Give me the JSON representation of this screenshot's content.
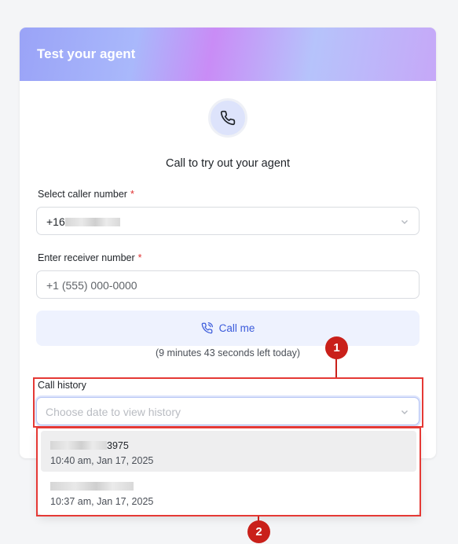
{
  "card": {
    "title": "Test your agent",
    "subtitle": "Call to try out your agent",
    "phone_icon": "phone-icon"
  },
  "caller": {
    "label": "Select caller number",
    "required_mark": "*",
    "value_prefix": "+16",
    "dropdown_icon": "chevron-down-icon"
  },
  "receiver": {
    "label": "Enter receiver number",
    "required_mark": "*",
    "placeholder": "+1 (555) 000-0000"
  },
  "call_button": {
    "label": "Call me",
    "icon": "phone-call-icon"
  },
  "time_left": "(9 minutes 43 seconds left today)",
  "history": {
    "label": "Call history",
    "placeholder": "Choose date to view history",
    "dropdown_icon": "chevron-down-icon",
    "items": [
      {
        "number_suffix": "3975",
        "time": "10:40 am, Jan 17, 2025"
      },
      {
        "number_suffix": "",
        "time": "10:37 am, Jan 17, 2025"
      }
    ]
  },
  "annotations": {
    "badge_1": "1",
    "badge_2": "2",
    "color": "#e53935"
  },
  "colors": {
    "accent": "#3b5bdb",
    "required": "#e03131",
    "annotation": "#c9201a"
  }
}
